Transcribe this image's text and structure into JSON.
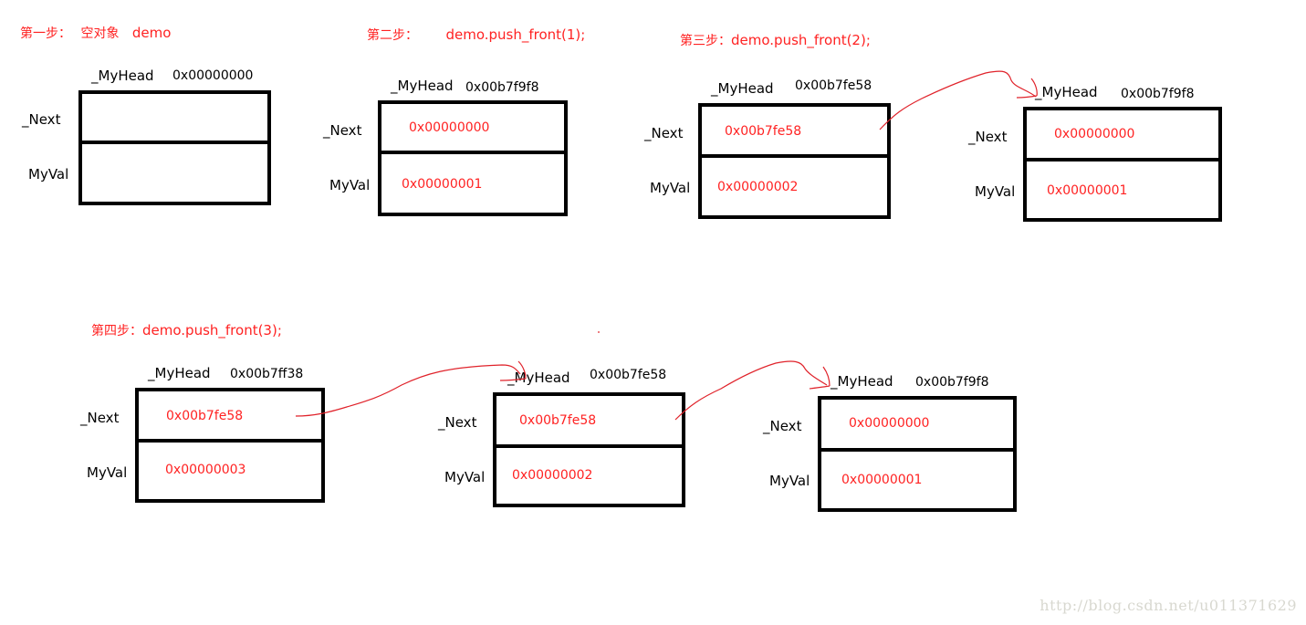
{
  "steps": [
    {
      "label": "第一步：",
      "desc": "空对象",
      "cmd": "demo"
    },
    {
      "label": "第二步：",
      "cmd": "demo.push_front(1);"
    },
    {
      "label": "第三步：",
      "cmd": "demo.push_front(2);"
    },
    {
      "label": "第四步：",
      "cmd": "demo.push_front(3);"
    }
  ],
  "field_labels": {
    "head": "_MyHead",
    "next": "_Next",
    "val": "MyVal"
  },
  "nodes": {
    "s1n1": {
      "address": "0x00000000",
      "next": "",
      "val": ""
    },
    "s2n1": {
      "address": "0x00b7f9f8",
      "next": "0x00000000",
      "val": "0x00000001"
    },
    "s3n1": {
      "address": "0x00b7fe58",
      "next": "0x00b7fe58",
      "val": "0x00000002"
    },
    "s3n2": {
      "address": "0x00b7f9f8",
      "next": "0x00000000",
      "val": "0x00000001"
    },
    "s4n1": {
      "address": "0x00b7ff38",
      "next": "0x00b7fe58",
      "val": "0x00000003"
    },
    "s4n2": {
      "address": "0x00b7fe58",
      "next": "0x00b7fe58",
      "val": "0x00000002"
    },
    "s4n3": {
      "address": "0x00b7f9f8",
      "next": "0x00000000",
      "val": "0x00000001"
    }
  },
  "colors": {
    "annotation": "#ff2222",
    "arrow": "#e0222a",
    "box": "#000000"
  },
  "watermark": "http://blog.csdn.net/u011371629"
}
